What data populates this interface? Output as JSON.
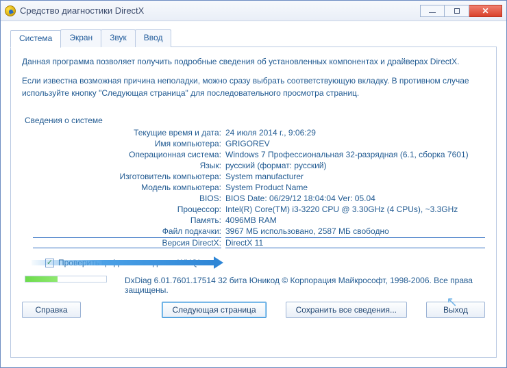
{
  "window": {
    "title": "Средство диагностики DirectX"
  },
  "tabs": {
    "system": "Система",
    "display": "Экран",
    "sound": "Звук",
    "input": "Ввод"
  },
  "intro": {
    "p1": "Данная программа позволяет получить подробные сведения об установленных компонентах и драйверах DirectX.",
    "p2": "Если известна возможная причина неполадки, можно сразу выбрать соответствующую вкладку. В противном случае используйте кнопку \"Следующая страница\" для последовательного просмотра страниц."
  },
  "group_label": "Сведения о системе",
  "rows": {
    "datetime": {
      "k": "Текущие время и дата:",
      "v": "24 июля 2014 г., 9:06:29"
    },
    "pcname": {
      "k": "Имя компьютера:",
      "v": "GRIGOREV"
    },
    "os": {
      "k": "Операционная система:",
      "v": "Windows 7 Профессиональная 32-разрядная (6.1, сборка 7601)"
    },
    "lang": {
      "k": "Язык:",
      "v": "русский (формат: русский)"
    },
    "mfr": {
      "k": "Изготовитель компьютера:",
      "v": "System manufacturer"
    },
    "model": {
      "k": "Модель компьютера:",
      "v": "System Product Name"
    },
    "bios": {
      "k": "BIOS:",
      "v": "BIOS Date: 06/29/12 18:04:04 Ver: 05.04"
    },
    "cpu": {
      "k": "Процессор:",
      "v": "Intel(R) Core(TM) i3-3220 CPU @ 3.30GHz (4 CPUs), ~3.3GHz"
    },
    "ram": {
      "k": "Память:",
      "v": "4096MB RAM"
    },
    "page": {
      "k": "Файл подкачки:",
      "v": "3967 МБ использовано, 2587 МБ свободно"
    },
    "dxver": {
      "k": "Версия DirectX:",
      "v": "DirectX 11"
    }
  },
  "whql_check_label": "Проверить цифровые подписи WHQL",
  "footer": "DxDiag 6.01.7601.17514 32 бита Юникод   © Корпорация Майкрософт, 1998-2006.  Все права защищены.",
  "buttons": {
    "help": "Справка",
    "next": "Следующая страница",
    "save": "Сохранить все сведения...",
    "exit": "Выход"
  }
}
